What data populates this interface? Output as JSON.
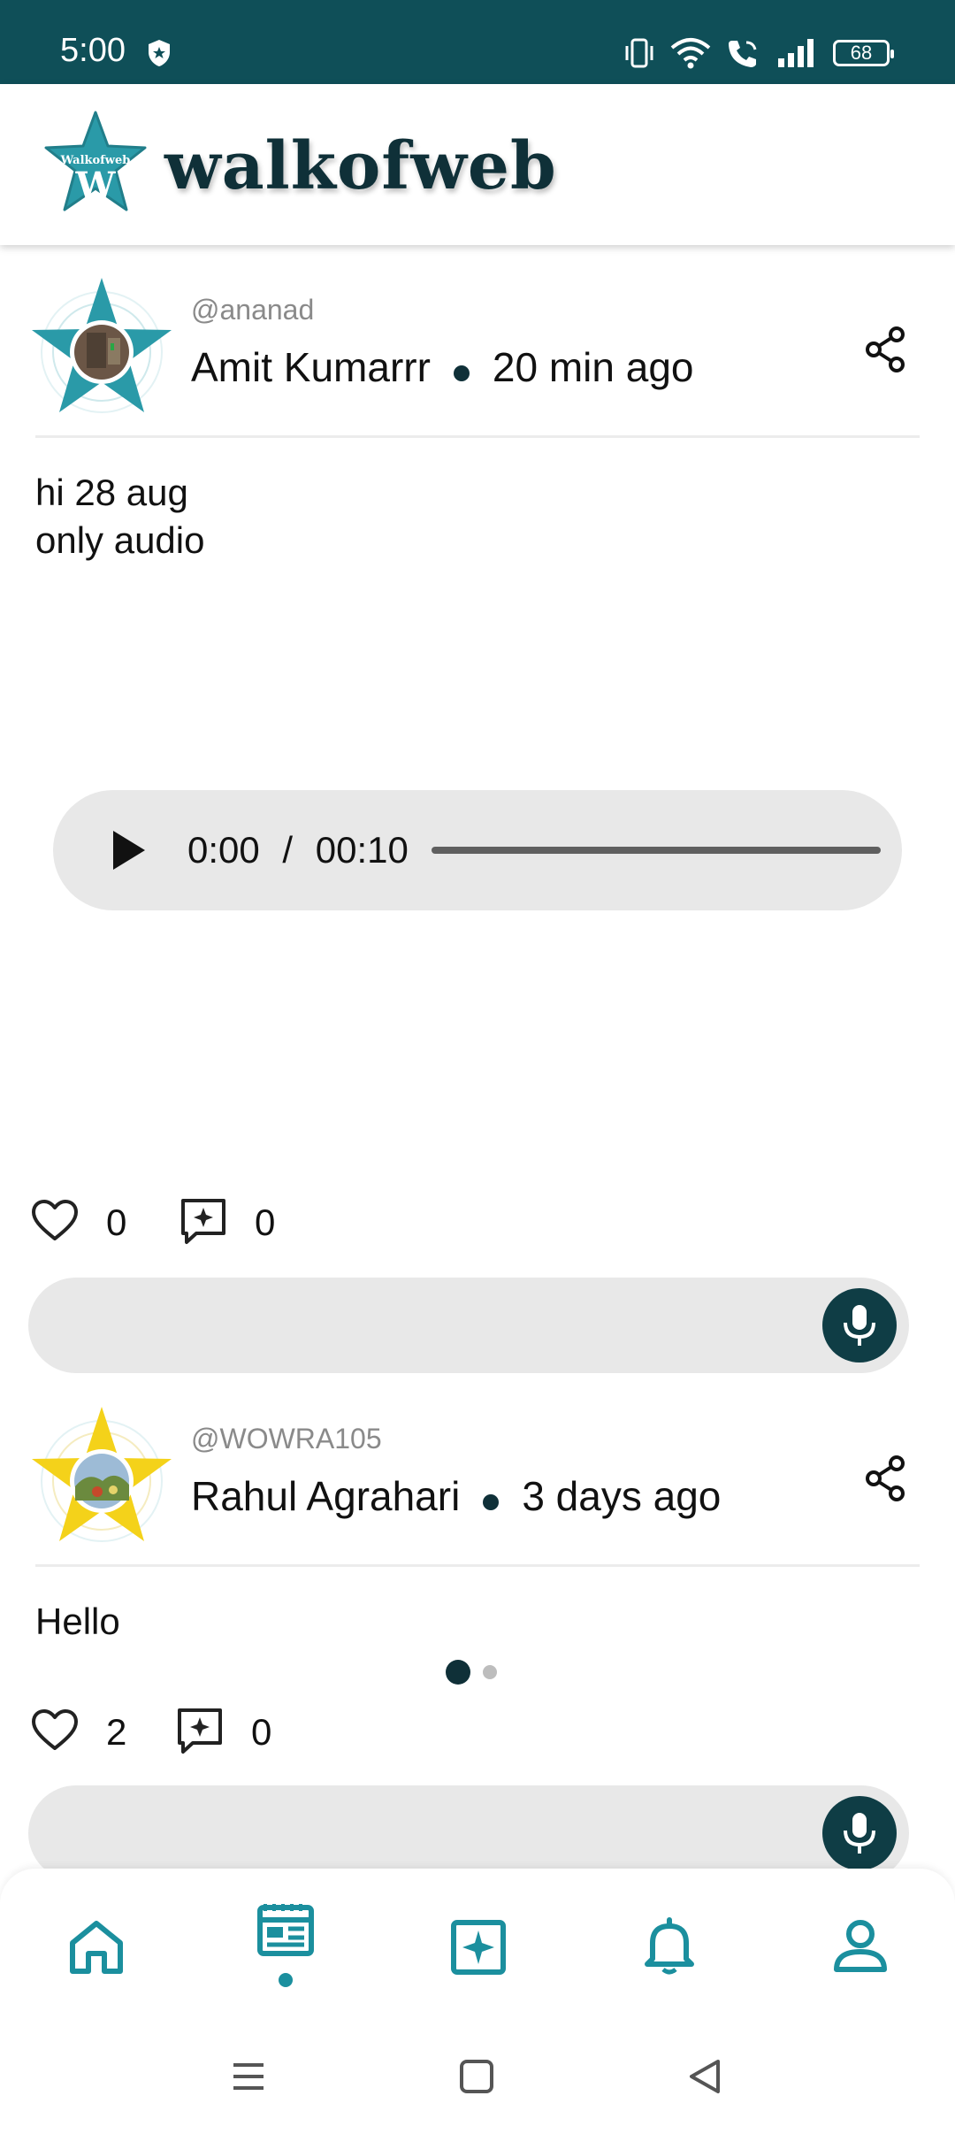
{
  "status_bar": {
    "time": "5:00",
    "battery": "68",
    "icons": [
      "shield-icon",
      "vibrate-icon",
      "wifi-icon",
      "wifi-call-icon",
      "signal-icon",
      "battery-icon"
    ]
  },
  "header": {
    "logo_text": "Walkofweb",
    "title": "walkofweb"
  },
  "posts": [
    {
      "handle": "@ananad",
      "name": "Amit Kumarrr",
      "time": "20 min ago",
      "text_line1": "hi  28 aug",
      "text_line2": "only audio",
      "audio": {
        "current": "0:00",
        "separator": "/",
        "duration": "00:10"
      },
      "likes": "0",
      "comments": "0",
      "star_color": "#2a9aa8"
    },
    {
      "handle": "@WOWRA105",
      "name": "Rahul Agrahari",
      "time": "3 days ago",
      "text_line1": "Hello",
      "likes": "2",
      "comments": "0",
      "star_color": "#f4d21a",
      "carousel": {
        "count": 2,
        "active": 1
      }
    }
  ],
  "bottom_nav": {
    "items": [
      "home-icon",
      "feed-icon",
      "sparkle-post-icon",
      "bell-icon",
      "profile-icon"
    ],
    "active": "feed-icon",
    "accent": "#1b8f9e"
  },
  "colors": {
    "status_bar": "#0f4f58",
    "dark_teal": "#0f3d45",
    "accent": "#1b8f9e"
  }
}
